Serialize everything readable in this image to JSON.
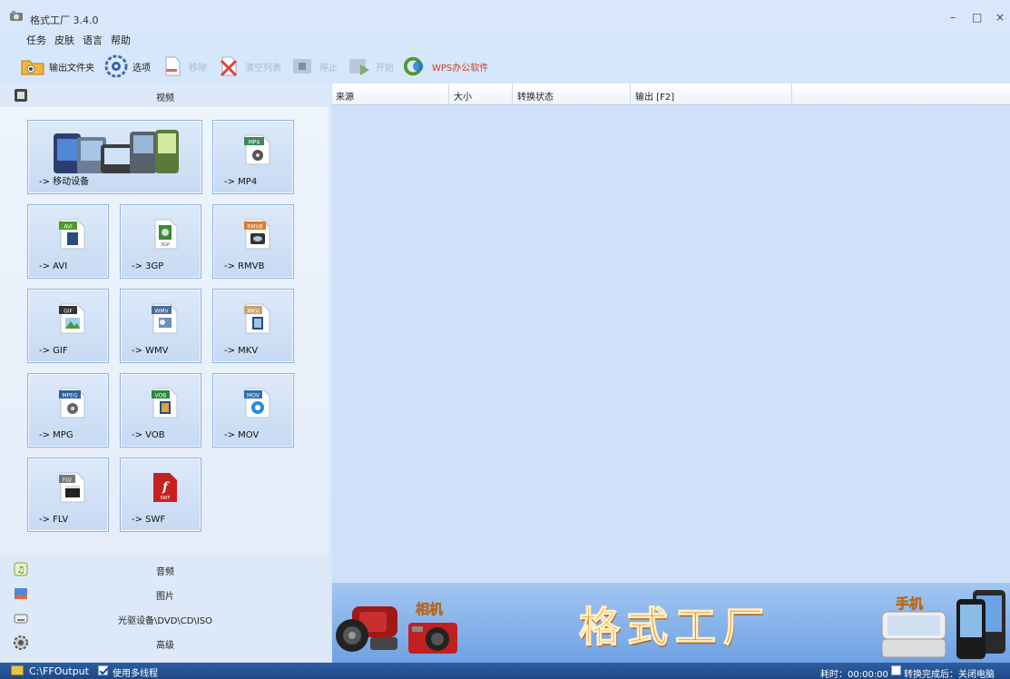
{
  "window": {
    "title": "格式工厂 3.4.0",
    "controls": [
      "–",
      "□",
      "×"
    ]
  },
  "menu": [
    "任务",
    "皮肤",
    "语言",
    "帮助"
  ],
  "toolbar": {
    "output_folder": "输出文件夹",
    "options": "选项",
    "remove": "移除",
    "clear_list": "清空列表",
    "stop": "停止",
    "start": "开始",
    "wps": "WPS办公软件"
  },
  "categories": {
    "video": "视频",
    "audio": "音频",
    "picture": "图片",
    "rom": "光驱设备\\DVD\\CD\\ISO",
    "advanced": "高级"
  },
  "tiles": {
    "mobile": "-> 移动设备",
    "mp4": "-> MP4",
    "avi": "-> AVI",
    "3gp": "-> 3GP",
    "rmvb": "-> RMVB",
    "gif": "-> GIF",
    "wmv": "-> WMV",
    "mkv": "-> MKV",
    "mpg": "-> MPG",
    "vob": "-> VOB",
    "mov": "-> MOV",
    "flv": "-> FLV",
    "swf": "-> SWF"
  },
  "file_badges": {
    "mp4": "MP4",
    "avi": "AVI",
    "3gp": "3GP",
    "rmvb": "RMVB",
    "gif": "GIF",
    "wmv": "WMV",
    "mkv": "MKV",
    "mpg": "MPEG",
    "vob": "VOB",
    "mov": "MOV",
    "flv": "FLV",
    "swf": "SWF"
  },
  "columns": [
    "来源",
    "大小",
    "转换状态",
    "输出 [F2]"
  ],
  "banner": {
    "camera_label": "相机",
    "phone_label": "手机",
    "logo": "格式工厂"
  },
  "status": {
    "output_path": "C:\\FFOutput",
    "multithread_label": "使用多线程",
    "elapsed": "耗时：00:00:00",
    "after_convert": "转换完成后：关闭电脑"
  },
  "colors": {
    "tile_border": "#8db2e3",
    "status_bg": "#1d4886",
    "logo_orange": "#f08a16",
    "wps_red": "#d33a18"
  }
}
